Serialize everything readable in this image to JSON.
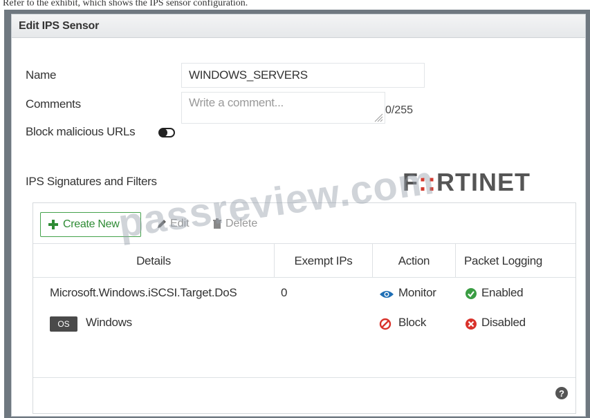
{
  "page_caption": "Refer to the exhibit, which shows the IPS sensor configuration.",
  "panel": {
    "title": "Edit IPS Sensor"
  },
  "form": {
    "name_label": "Name",
    "name_value": "WINDOWS_SERVERS",
    "comments_label": "Comments",
    "comments_placeholder": "Write a comment...",
    "comments_counter": "0/255",
    "block_urls_label": "Block malicious URLs",
    "block_urls_enabled": false
  },
  "section": {
    "title": "IPS Signatures and Filters"
  },
  "logo": {
    "left": "F",
    "mid": "::",
    "right": "RTINET"
  },
  "watermark": "passreview.com",
  "toolbar": {
    "create_new_label": "Create New",
    "edit_label": "Edit",
    "delete_label": "Delete"
  },
  "table": {
    "columns": [
      "Details",
      "Exempt IPs",
      "Action",
      "Packet Logging"
    ],
    "rows": [
      {
        "details": "Microsoft.Windows.iSCSI.Target.DoS",
        "exempt_ips": "0",
        "action": "Monitor",
        "packet_logging": "Enabled"
      },
      {
        "badge": "OS",
        "details": "Windows",
        "exempt_ips": "",
        "action": "Block",
        "packet_logging": "Disabled"
      }
    ]
  },
  "colors": {
    "accent_green": "#2e8b34",
    "monitor_blue": "#1f6fb5",
    "block_red": "#d9322b",
    "enabled_green": "#3a9d43",
    "disabled_red": "#d9322b"
  }
}
